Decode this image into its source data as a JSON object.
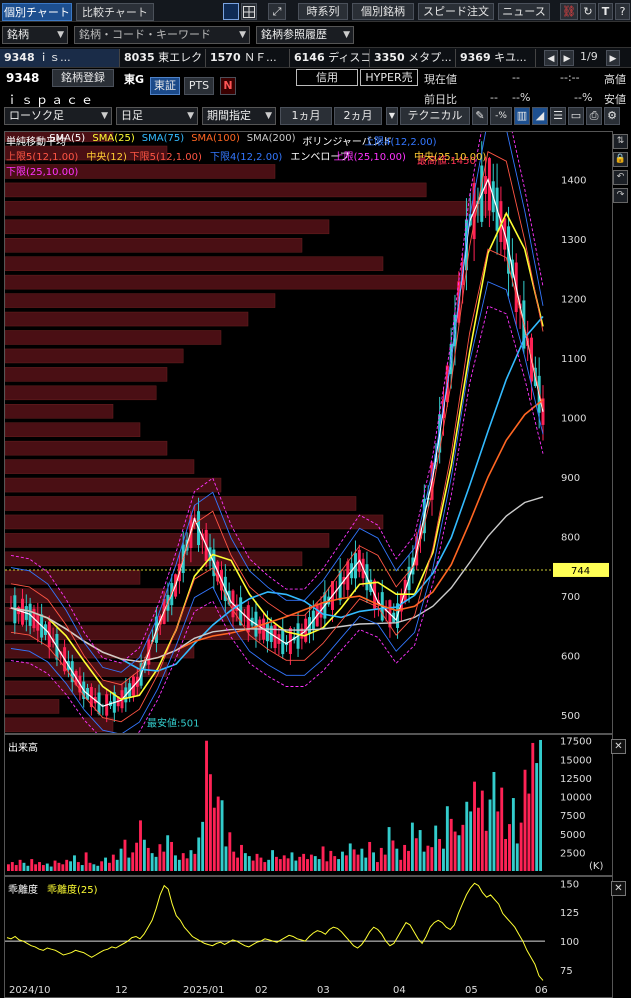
{
  "tabs": {
    "individual": "個別チャート",
    "compare": "比較チャート"
  },
  "toolbar": {
    "timeseries": "時系列",
    "individual_stock": "個別銘柄",
    "speed_order": "スピード注文",
    "news": "ニュース"
  },
  "search_row": {
    "stock_label": "銘柄",
    "search_placeholder": "銘柄・コード・キーワード",
    "history_label": "銘柄参照履歴"
  },
  "quote_tabs": [
    {
      "code": "9348",
      "name": "ｉｓ..."
    },
    {
      "code": "8035",
      "name": "東エレク"
    },
    {
      "code": "1570",
      "name": "ＮＦ..."
    },
    {
      "code": "6146",
      "name": "ディスコ"
    },
    {
      "code": "3350",
      "name": "メタプ..."
    },
    {
      "code": "9369",
      "name": "キユ..."
    }
  ],
  "page_indicator": "1/9",
  "stock": {
    "code": "9348",
    "name": "ｉｓｐａｃｅ",
    "register_label": "銘柄登録",
    "market": "東G",
    "exchange_tse": "東証",
    "exchange_pts": "PTS",
    "credit": "信用",
    "hyper": "HYPER売",
    "current_label": "現在値",
    "current_value": "--",
    "time_value": "--:--",
    "change_label": "前日比",
    "change_value": "--",
    "change_pct": "--%",
    "pct_unit": "%",
    "high_label": "高値",
    "low_label": "安値"
  },
  "controls": {
    "chart_type": "ローソク足",
    "period": "日足",
    "range_label": "期間指定",
    "range_1m": "1ヵ月",
    "range_2m": "2ヵ月",
    "technical": "テクニカル"
  },
  "legend": {
    "line1": [
      {
        "text": "単純移動平均",
        "color": "#ffffff"
      },
      {
        "text": "SMA(5)",
        "color": "#ffffff"
      },
      {
        "text": "SMA(25)",
        "color": "#ffff33"
      },
      {
        "text": "SMA(75)",
        "color": "#33bbff"
      },
      {
        "text": "SMA(100)",
        "color": "#ff6622"
      },
      {
        "text": "SMA(200)",
        "color": "#cccccc"
      },
      {
        "text": "ボリンジャーバンド",
        "color": "#ffffff"
      },
      {
        "text": "上限4(12,2.00)",
        "color": "#3377ff"
      }
    ],
    "line2": [
      {
        "text": "上限5(12,1.00)",
        "color": "#ff5544"
      },
      {
        "text": "中央(12)",
        "color": "#ffcc33"
      },
      {
        "text": "下限5(12,1.00)",
        "color": "#ff5544"
      },
      {
        "text": "下限4(12,2.00)",
        "color": "#3377ff"
      },
      {
        "text": "エンベロープ",
        "color": "#ffffff"
      },
      {
        "text": "上限(25,10.00)",
        "color": "#ff33ff"
      },
      {
        "text": "中央(25,10.00)",
        "color": "#ffcc33"
      }
    ],
    "line3": [
      {
        "text": "下限(25,10.00)",
        "color": "#ff33ff"
      }
    ]
  },
  "annotations": {
    "high": "最高値:1450",
    "low": "最安値:501"
  },
  "current_price_tag": "744",
  "volume_panel": {
    "title": "出来高",
    "unit": "(K)"
  },
  "deviation_panel": {
    "title": "乖離度",
    "series": "乖離度(25)"
  },
  "x_labels": [
    "2024/10",
    "12",
    "2025/01",
    "02",
    "03",
    "04",
    "05",
    "06"
  ],
  "chart_data": [
    {
      "type": "candlestick",
      "title": "",
      "y_ticks": [
        500,
        600,
        700,
        800,
        900,
        1000,
        1100,
        1200,
        1300,
        1400
      ],
      "ylim": [
        470,
        1480
      ],
      "x_month_labels": [
        "2024/10",
        "12",
        "2025/01",
        "02",
        "03",
        "04",
        "05",
        "06"
      ],
      "highest": 1450,
      "lowest": 501,
      "last": 744,
      "close_path": [
        {
          "date": "2024/10",
          "value": 680
        },
        {
          "date": "2024/10",
          "value": 670
        },
        {
          "date": "2024/11",
          "value": 640
        },
        {
          "date": "2024/11",
          "value": 590
        },
        {
          "date": "2024/11",
          "value": 540
        },
        {
          "date": "2024/12",
          "value": 515
        },
        {
          "date": "2024/12",
          "value": 525
        },
        {
          "date": "2024/12",
          "value": 560
        },
        {
          "date": "2024/12",
          "value": 650
        },
        {
          "date": "2025/01",
          "value": 720
        },
        {
          "date": "2025/01",
          "value": 830
        },
        {
          "date": "2025/01",
          "value": 760
        },
        {
          "date": "2025/01",
          "value": 690
        },
        {
          "date": "2025/02",
          "value": 660
        },
        {
          "date": "2025/02",
          "value": 640
        },
        {
          "date": "2025/02",
          "value": 620
        },
        {
          "date": "2025/03",
          "value": 640
        },
        {
          "date": "2025/03",
          "value": 680
        },
        {
          "date": "2025/03",
          "value": 720
        },
        {
          "date": "2025/04",
          "value": 760
        },
        {
          "date": "2025/04",
          "value": 690
        },
        {
          "date": "2025/04",
          "value": 660
        },
        {
          "date": "2025/04",
          "value": 760
        },
        {
          "date": "2025/05",
          "value": 900
        },
        {
          "date": "2025/05",
          "value": 1100
        },
        {
          "date": "2025/05",
          "value": 1330
        },
        {
          "date": "2025/05",
          "value": 1400
        },
        {
          "date": "2025/06",
          "value": 1300
        },
        {
          "date": "2025/06",
          "value": 1150
        },
        {
          "date": "2025/06",
          "value": 1010
        }
      ],
      "series": [
        {
          "name": "SMA(5)",
          "color": "#ffffff"
        },
        {
          "name": "SMA(25)",
          "color": "#ffff33"
        },
        {
          "name": "SMA(75)",
          "color": "#33bbff"
        },
        {
          "name": "SMA(100)",
          "color": "#ff6622"
        },
        {
          "name": "SMA(200)",
          "color": "#cccccc"
        }
      ]
    },
    {
      "type": "bar",
      "title": "出来高",
      "unit": "K",
      "y_ticks": [
        2500,
        5000,
        7500,
        10000,
        12500,
        15000,
        17500
      ],
      "ylim": [
        0,
        18000
      ],
      "values": [
        900,
        1200,
        800,
        1500,
        1100,
        700,
        1600,
        900,
        1200,
        800,
        1000,
        600,
        1400,
        1100,
        900,
        1500,
        1300,
        2100,
        1200,
        800,
        2500,
        1100,
        900,
        700,
        1300,
        1800,
        1100,
        2200,
        1500,
        3000,
        4200,
        1800,
        2500,
        3800,
        6800,
        4200,
        3100,
        2400,
        1900,
        3600,
        2600,
        4800,
        3900,
        2100,
        1500,
        2400,
        1700,
        2800,
        2300,
        4500,
        6600,
        17500,
        13000,
        8500,
        10000,
        9500,
        3300,
        5200,
        2600,
        1800,
        3500,
        2400,
        2000,
        1400,
        2300,
        1800,
        1200,
        1500,
        2800,
        1900,
        1600,
        2100,
        1700,
        2500,
        1400,
        1900,
        2300,
        1600,
        2200,
        2000,
        1600,
        3300,
        1300,
        2700,
        2000,
        1600,
        2600,
        2100,
        3700,
        2900,
        2200,
        3000,
        1800,
        3900,
        2500,
        1200,
        3100,
        2200,
        5900,
        4100,
        3000,
        1500,
        3500,
        2700,
        6500,
        4400,
        5500,
        2600,
        3400,
        3200,
        6100,
        4300,
        3000,
        8700,
        7000,
        5300,
        4800,
        6200,
        9300,
        8000,
        12000,
        8500,
        10800,
        5400,
        9600,
        13300,
        8000,
        11200,
        4300,
        6300,
        9800,
        3700,
        6500,
        13600,
        10400,
        17200,
        14500,
        17600
      ],
      "colors_note": "alternating up/down"
    },
    {
      "type": "line",
      "title": "乖離度(25)",
      "y_ticks": [
        75,
        100,
        125,
        150
      ],
      "ylim": [
        62,
        152
      ],
      "values": [
        103,
        102,
        104,
        101,
        100,
        98,
        96,
        95,
        93,
        92,
        94,
        93,
        92,
        90,
        88,
        89,
        90,
        92,
        91,
        90,
        88,
        86,
        88,
        90,
        92,
        93,
        95,
        94,
        96,
        98,
        100,
        103,
        104,
        102,
        106,
        112,
        118,
        128,
        140,
        148,
        145,
        132,
        122,
        118,
        112,
        108,
        104,
        102,
        100,
        98,
        97,
        96,
        98,
        99,
        97,
        99,
        101,
        100,
        98,
        96,
        95,
        97,
        99,
        100,
        102,
        101,
        100,
        99,
        101,
        103,
        105,
        104,
        102,
        101,
        100,
        104,
        107,
        109,
        108,
        106,
        110,
        112,
        111,
        108,
        104,
        100,
        96,
        94,
        97,
        102,
        108,
        112,
        110,
        106,
        100,
        96,
        98,
        104,
        110,
        116,
        114,
        108,
        102,
        98,
        104,
        112,
        116,
        118,
        116,
        112,
        110,
        114,
        124,
        132,
        140,
        146,
        150,
        148,
        142,
        138,
        140,
        136,
        132,
        124,
        120,
        116,
        112,
        106,
        100,
        92,
        86,
        80,
        70,
        66
      ]
    }
  ]
}
